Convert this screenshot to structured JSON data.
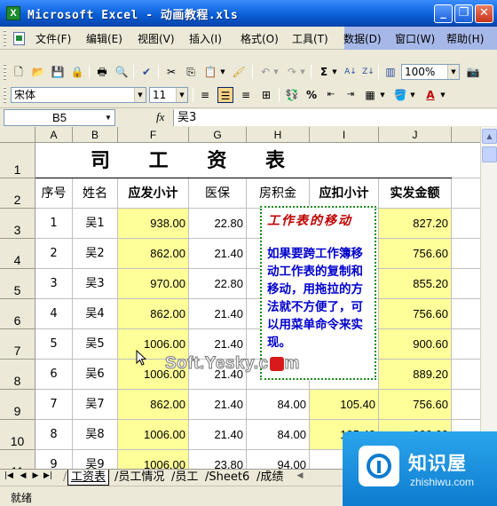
{
  "window": {
    "title": "Microsoft Excel - 动画教程.xls",
    "app_icon": "X"
  },
  "menu": [
    "文件(F)",
    "编辑(E)",
    "视图(V)",
    "插入(I)",
    "格式(O)",
    "工具(T)",
    "数据(D)",
    "窗口(W)",
    "帮助(H)"
  ],
  "toolbar": {
    "zoom": "100%",
    "font": "宋体",
    "font_size": "11",
    "align_active": "center"
  },
  "formula_bar": {
    "name_box": "B5",
    "fx": "fx",
    "value": "吴3"
  },
  "columns": [
    "A",
    "B",
    "F",
    "G",
    "H",
    "I",
    "J"
  ],
  "row_numbers": [
    "1",
    "2",
    "3",
    "4",
    "5",
    "6",
    "7",
    "8",
    "9",
    "10",
    "11"
  ],
  "sheet_title": "公司工资表",
  "sheet_title_visible": "司 工 资 表",
  "headers": [
    "序号",
    "姓名",
    "应发小计",
    "医保",
    "房积金",
    "应扣小计",
    "实发金额"
  ],
  "rows": [
    {
      "seq": "1",
      "name": "吴1",
      "gross": "938.00",
      "medical": "22.80",
      "fund": "",
      "deduct": "",
      "net": "827.20"
    },
    {
      "seq": "2",
      "name": "吴2",
      "gross": "862.00",
      "medical": "21.40",
      "fund": "",
      "deduct": "",
      "net": "756.60"
    },
    {
      "seq": "3",
      "name": "吴3",
      "gross": "970.00",
      "medical": "22.80",
      "fund": "",
      "deduct": "",
      "net": "855.20"
    },
    {
      "seq": "4",
      "name": "吴4",
      "gross": "862.00",
      "medical": "21.40",
      "fund": "",
      "deduct": "",
      "net": "756.60"
    },
    {
      "seq": "5",
      "name": "吴5",
      "gross": "1006.00",
      "medical": "21.40",
      "fund": "",
      "deduct": "",
      "net": "900.60"
    },
    {
      "seq": "6",
      "name": "吴6",
      "gross": "1006.00",
      "medical": "21.40",
      "fund": "",
      "deduct": "",
      "net": "889.20"
    },
    {
      "seq": "7",
      "name": "吴7",
      "gross": "862.00",
      "medical": "21.40",
      "fund": "84.00",
      "deduct": "105.40",
      "net": "756.60"
    },
    {
      "seq": "8",
      "name": "吴8",
      "gross": "1006.00",
      "medical": "21.40",
      "fund": "84.00",
      "deduct": "105.40",
      "net": "900.60"
    },
    {
      "seq": "9",
      "name": "吴9",
      "gross": "1006.00",
      "medical": "23.80",
      "fund": "94.00",
      "deduct": "",
      "net": ""
    }
  ],
  "note": {
    "title": "工作表的移动",
    "body": "如果要跨工作簿移动工作表的复制和移动，用拖拉的方法就不方便了，可以用菜单命令来实现。"
  },
  "watermark": "Soft.Yesky.c",
  "watermark_tail": "m",
  "sheet_tabs": [
    "工资表",
    "员工情况",
    "员工",
    "Sheet6",
    "成绩"
  ],
  "status": "就绪",
  "logo": {
    "name": "知识屋",
    "url": "zhishiwu.com"
  },
  "colors": {
    "title_blue": "#0a5fd8",
    "cell_yellow": "#ffff99",
    "note_red": "#c00000",
    "note_blue": "#0000cc",
    "note_border": "#1c8a1c"
  }
}
